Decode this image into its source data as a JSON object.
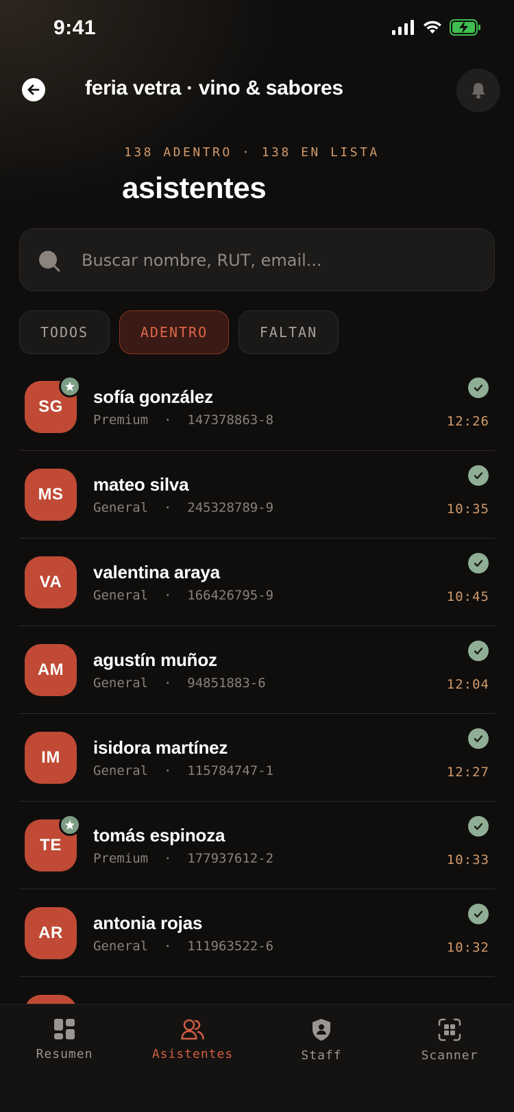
{
  "status_bar": {
    "time": "9:41"
  },
  "header": {
    "title": "feria vetra · vino & sabores",
    "back_icon": "arrow-left-icon",
    "bell_icon": "bell-icon"
  },
  "summary": {
    "subtitle": "138 ADENTRO · 138 EN LISTA",
    "title": "asistentes"
  },
  "search": {
    "placeholder": "Buscar nombre, RUT, email...",
    "value": ""
  },
  "filters": {
    "todos": "TODOS",
    "adentro": "ADENTRO",
    "faltan": "FALTAN",
    "selected": "ADENTRO"
  },
  "attendees": [
    {
      "initials": "SG",
      "name": "sofía gonzález",
      "meta": "Premium  ·  147378863-8",
      "time": "12:26",
      "premium": true
    },
    {
      "initials": "MS",
      "name": "mateo silva",
      "meta": "General  ·  245328789-9",
      "time": "10:35",
      "premium": false
    },
    {
      "initials": "VA",
      "name": "valentina araya",
      "meta": "General  ·  166426795-9",
      "time": "10:45",
      "premium": false
    },
    {
      "initials": "AM",
      "name": "agustín muñoz",
      "meta": "General  ·  94851883-6",
      "time": "12:04",
      "premium": false
    },
    {
      "initials": "IM",
      "name": "isidora martínez",
      "meta": "General  ·  115784747-1",
      "time": "12:27",
      "premium": false
    },
    {
      "initials": "TE",
      "name": "tomás espinoza",
      "meta": "Premium  ·  177937612-2",
      "time": "10:33",
      "premium": true
    },
    {
      "initials": "AR",
      "name": "antonia rojas",
      "meta": "General  ·  111963522-6",
      "time": "10:32",
      "premium": false
    }
  ],
  "tabs": {
    "resumen": "Resumen",
    "asistentes": "Asistentes",
    "staff": "Staff",
    "scanner": "Scanner",
    "active": "Asistentes"
  },
  "colors": {
    "accent": "#c04a35",
    "gold": "#d39a6a",
    "success": "#8fae95",
    "background": "#0f0e0d"
  }
}
